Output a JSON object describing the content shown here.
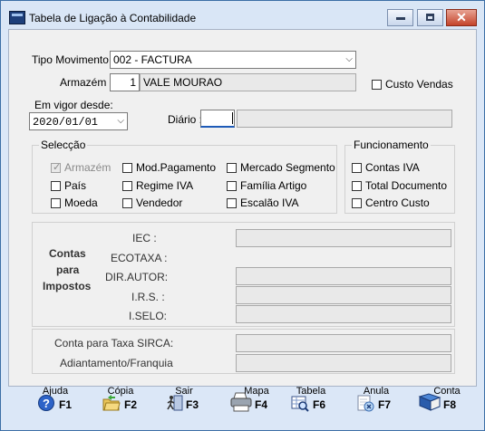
{
  "window": {
    "title": "Tabela de Ligação à Contabilidade",
    "minimize_glyph": "",
    "maximize_glyph": "",
    "close_glyph": "✕"
  },
  "form": {
    "tipo_movimento_label": "Tipo Movimento :",
    "tipo_movimento_value": "002 - FACTURA",
    "armazem_label": "Armazém :",
    "armazem_code": "1",
    "armazem_name": "VALE MOURAO",
    "custo_vendas_label": "Custo Vendas",
    "em_vigor_label": "Em vigor desde:",
    "em_vigor_value": "2020/01/01",
    "diario_label": "Diário :",
    "diario_value": "",
    "diario_desc": ""
  },
  "seleccao": {
    "title": "Selecção",
    "items": [
      "Armazém",
      "País",
      "Moeda",
      "Mod.Pagamento",
      "Regime IVA",
      "Vendedor",
      "Mercado Segmento",
      "Família Artigo",
      "Escalão IVA"
    ]
  },
  "funcionamento": {
    "title": "Funcionamento",
    "items": [
      "Contas IVA",
      "Total Documento",
      "Centro Custo"
    ]
  },
  "impostos": {
    "section_label": [
      "Contas",
      "para",
      "Impostos"
    ],
    "rows": [
      "IEC :",
      "ECOTAXA :",
      "DIR.AUTOR:",
      "I.R.S. :",
      "I.SELO:"
    ]
  },
  "other": {
    "taxa_sirca_label": "Conta para Taxa SIRCA:",
    "adiantamento_label": "Adiantamento/Franquia"
  },
  "toolbar": [
    {
      "top": "Ajuda",
      "key": "F1",
      "icon": "help-icon"
    },
    {
      "top": "Cópia",
      "key": "F2",
      "icon": "copy-folder-icon"
    },
    {
      "top": "Sair",
      "key": "F3",
      "icon": "exit-icon"
    },
    {
      "top": "Mapa",
      "key": "F4",
      "icon": "printer-icon"
    },
    {
      "top": "Tabela",
      "key": "F6",
      "icon": "table-search-icon"
    },
    {
      "top": "Anula",
      "key": "F7",
      "icon": "cancel-icon"
    },
    {
      "top": "Conta",
      "key": "F8",
      "icon": "books-icon"
    }
  ],
  "colors": {
    "accent": "#1d3f7a",
    "close": "#c4442b",
    "frame": "#dbe7f7"
  }
}
